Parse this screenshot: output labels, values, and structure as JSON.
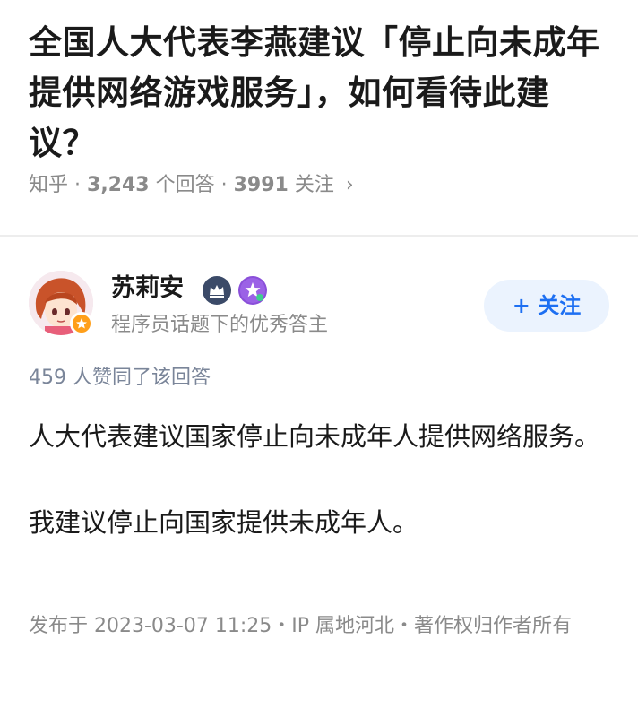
{
  "question": {
    "title": "全国人大代表李燕建议「停止向未成年提供网络游戏服务」，如何看待此建议？",
    "source": "知乎",
    "answers_count": "3,243",
    "answers_suffix": "个回答",
    "follow_count": "3991",
    "follow_suffix": "关注",
    "separator": "·",
    "chevron": "›"
  },
  "author": {
    "name": "苏莉安",
    "description": "程序员话题下的优秀答主",
    "avatar_icon": "anime-avatar",
    "avatar_badge_icon": "verified-badge-icon",
    "badges": [
      "crown-icon",
      "star-badge-icon"
    ],
    "follow_label": "+ 关注"
  },
  "answer": {
    "vote_text": "459 人赞同了该回答",
    "paragraphs": [
      "人大代表建议国家停止向未成年人提供网络服务。",
      "我建议停止向国家提供未成年人。"
    ],
    "footer": "发布于 2023-03-07 11:25・IP 属地河北・著作权归作者所有"
  },
  "colors": {
    "accent": "#1d6ff2",
    "follow_bg": "#ebf3fe",
    "muted": "#8a8a8a",
    "vote": "#7a8599",
    "badge_orange": "#ff9f1a",
    "crown_bg": "#3b4a68",
    "star_bg": "#8a4fd9"
  }
}
